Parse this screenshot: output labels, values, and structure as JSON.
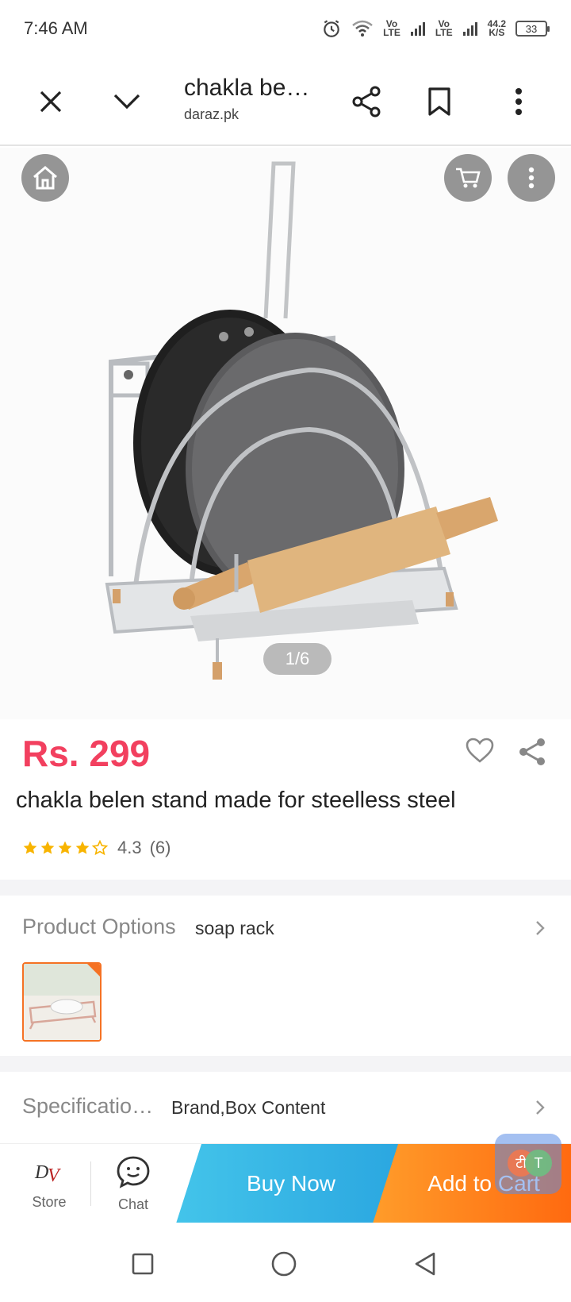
{
  "status_bar": {
    "time": "7:46 AM",
    "network_1": "Vo\nLTE",
    "network_2": "Vo\nLTE",
    "speed": "44.2\nK/S",
    "battery": "33"
  },
  "browser": {
    "page_title": "chakla be…",
    "url": "daraz.pk",
    "icons": [
      "close-icon",
      "chevron-down-icon",
      "share-icon",
      "bookmark-icon",
      "more-vert-icon"
    ]
  },
  "gallery": {
    "counter": "1/6",
    "icons": [
      "home-icon",
      "cart-icon",
      "more-vert-icon"
    ]
  },
  "product": {
    "price": "Rs. 299",
    "title": "chakla belen stand made for steelless steel",
    "rating": "4.3",
    "rating_count": "(6)",
    "stars": 4.3
  },
  "options": {
    "label": "Product Options",
    "value": "soap rack"
  },
  "specifications": {
    "label": "Specificatio…",
    "value": "Brand,Box Content"
  },
  "action_bar": {
    "store_label": "Store",
    "chat_label": "Chat",
    "buy_now": "Buy Now",
    "add_to_cart": "Add to Cart",
    "translate_1": "टी",
    "translate_2": "T"
  },
  "colors": {
    "price": "#f2405f",
    "buy_now": "#2aa6e0",
    "add_to_cart": "#ff6a10",
    "accent_border": "#f57224",
    "star": "#f8b400"
  },
  "nav": {
    "icons": [
      "recents-square-icon",
      "home-circle-icon",
      "back-triangle-icon"
    ]
  }
}
